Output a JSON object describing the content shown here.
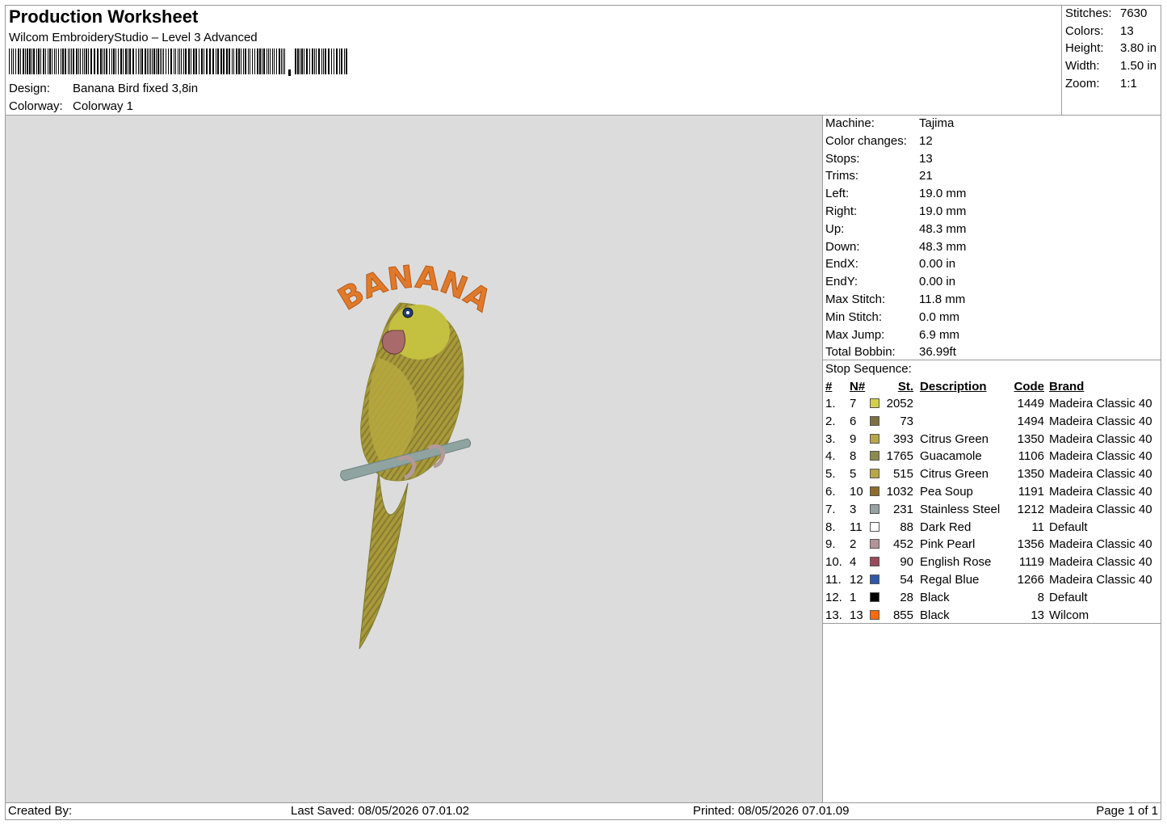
{
  "header": {
    "title": "Production Worksheet",
    "subtitle": "Wilcom EmbroideryStudio – Level 3 Advanced",
    "design_label": "Design:",
    "design_value": "Banana Bird fixed 3,8in",
    "colorway_label": "Colorway:",
    "colorway_value": "Colorway 1"
  },
  "summary": [
    {
      "label": "Stitches:",
      "value": "7630"
    },
    {
      "label": "Colors:",
      "value": "13"
    },
    {
      "label": "Height:",
      "value": "3.80 in"
    },
    {
      "label": "Width:",
      "value": "1.50 in"
    },
    {
      "label": "Zoom:",
      "value": "1:1"
    }
  ],
  "design_preview": {
    "text": "BANANA",
    "text_color": "#e07a2a",
    "body_color": "#a69a3a",
    "perch_color": "#8fa3a0",
    "beak_color": "#a86a6a",
    "eye_color": "#233c7a"
  },
  "machine_info": [
    {
      "label": "Machine:",
      "value": "Tajima"
    },
    {
      "label": "Color changes:",
      "value": "12"
    },
    {
      "label": "Stops:",
      "value": "13"
    },
    {
      "label": "Trims:",
      "value": "21"
    },
    {
      "label": "Left:",
      "value": "19.0 mm"
    },
    {
      "label": "Right:",
      "value": "19.0 mm"
    },
    {
      "label": "Up:",
      "value": "48.3 mm"
    },
    {
      "label": "Down:",
      "value": "48.3 mm"
    },
    {
      "label": "EndX:",
      "value": "0.00 in"
    },
    {
      "label": "EndY:",
      "value": "0.00 in"
    },
    {
      "label": "Max Stitch:",
      "value": "11.8 mm"
    },
    {
      "label": "Min Stitch:",
      "value": "0.0 mm"
    },
    {
      "label": "Max Jump:",
      "value": "6.9 mm"
    },
    {
      "label": "Total Bobbin:",
      "value": "36.99ft"
    }
  ],
  "stop_sequence": {
    "title": "Stop Sequence:",
    "headers": {
      "num": "#",
      "n": "N#",
      "st": "St.",
      "description": "Description",
      "code": "Code",
      "brand": "Brand"
    },
    "rows": [
      {
        "num": "1.",
        "n": "7",
        "color": "#d2d04a",
        "st": "2052",
        "description": "",
        "code": "1449",
        "brand": "Madeira Classic 40"
      },
      {
        "num": "2.",
        "n": "6",
        "color": "#7c7040",
        "st": "73",
        "description": "",
        "code": "1494",
        "brand": "Madeira Classic 40"
      },
      {
        "num": "3.",
        "n": "9",
        "color": "#b8a845",
        "st": "393",
        "description": "Citrus Green",
        "code": "1350",
        "brand": "Madeira Classic 40"
      },
      {
        "num": "4.",
        "n": "8",
        "color": "#8e8a4e",
        "st": "1765",
        "description": "Guacamole",
        "code": "1106",
        "brand": "Madeira Classic 40"
      },
      {
        "num": "5.",
        "n": "5",
        "color": "#b8a845",
        "st": "515",
        "description": "Citrus Green",
        "code": "1350",
        "brand": "Madeira Classic 40"
      },
      {
        "num": "6.",
        "n": "10",
        "color": "#8c6e2a",
        "st": "1032",
        "description": "Pea Soup",
        "code": "1191",
        "brand": "Madeira Classic 40"
      },
      {
        "num": "7.",
        "n": "3",
        "color": "#97a2a4",
        "st": "231",
        "description": "Stainless Steel",
        "code": "1212",
        "brand": "Madeira Classic 40"
      },
      {
        "num": "8.",
        "n": "11",
        "color": "#ffffff",
        "st": "88",
        "description": "Dark Red",
        "code": "11",
        "brand": "Default"
      },
      {
        "num": "9.",
        "n": "2",
        "color": "#b4949a",
        "st": "452",
        "description": "Pink Pearl",
        "code": "1356",
        "brand": "Madeira Classic 40"
      },
      {
        "num": "10.",
        "n": "4",
        "color": "#9a4a5a",
        "st": "90",
        "description": "English Rose",
        "code": "1119",
        "brand": "Madeira Classic 40"
      },
      {
        "num": "11.",
        "n": "12",
        "color": "#2e58a8",
        "st": "54",
        "description": "Regal Blue",
        "code": "1266",
        "brand": "Madeira Classic 40"
      },
      {
        "num": "12.",
        "n": "1",
        "color": "#000000",
        "st": "28",
        "description": "Black",
        "code": "8",
        "brand": "Default"
      },
      {
        "num": "13.",
        "n": "13",
        "color": "#ff6a10",
        "st": "855",
        "description": "Black",
        "code": "13",
        "brand": "Wilcom"
      }
    ]
  },
  "footer": {
    "created_by": "Created By:",
    "last_saved": "Last Saved: 08/05/2026 07.01.02",
    "printed": "Printed: 08/05/2026 07.01.09",
    "page": "Page 1 of 1"
  }
}
